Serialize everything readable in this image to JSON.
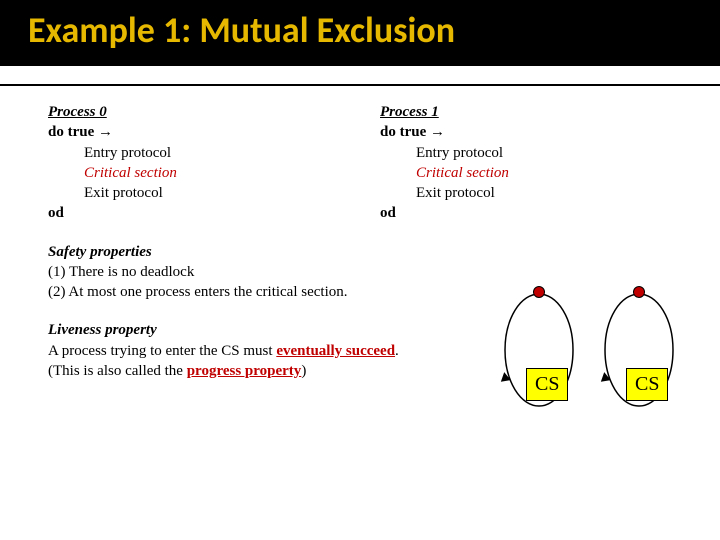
{
  "title": "Example 1: Mutual Exclusion",
  "p0": {
    "head": "Process 0",
    "do": "do true →",
    "entry": "Entry protocol",
    "crit": "Critical section",
    "exit": "Exit protocol",
    "od": "od"
  },
  "p1": {
    "head": "Process 1",
    "do": "do true →",
    "entry": "Entry protocol",
    "crit": "Critical section",
    "exit": "Exit protocol",
    "od": "od"
  },
  "safety": {
    "head": "Safety properties",
    "l1": "(1) There is no deadlock",
    "l2": "(2) At most one process enters the critical section."
  },
  "liveness": {
    "head": "Liveness property",
    "pre": "A process trying to enter the CS must ",
    "ev": "eventually succeed",
    "post": ".",
    "pre2": "(This is also called the ",
    "pp": "progress property",
    "post2": ")"
  },
  "cs": {
    "a": "CS",
    "b": "CS"
  }
}
